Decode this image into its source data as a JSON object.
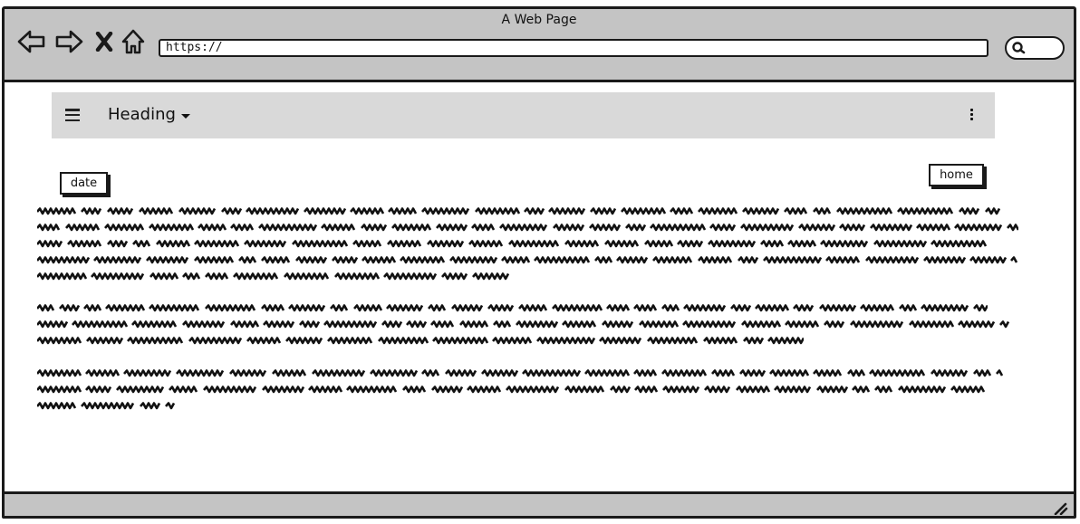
{
  "browser": {
    "title": "A Web Page",
    "url": "https://",
    "icons": {
      "back": "arrow-left-icon",
      "forward": "arrow-right-icon",
      "stop": "close-icon",
      "home": "home-icon",
      "search": "search-icon",
      "resize": "resize-grip-icon"
    }
  },
  "appbar": {
    "heading": "Heading",
    "icons": {
      "menu": "hamburger-icon",
      "dropdown": "caret-down-icon",
      "more": "kebab-icon"
    }
  },
  "buttons": {
    "date": "date",
    "home": "home"
  },
  "paragraphs": [
    {
      "lines": 5,
      "last_line_fraction": 0.48
    },
    {
      "lines": 3,
      "last_line_fraction": 0.78
    },
    {
      "lines": 3,
      "last_line_fraction": 0.14
    }
  ]
}
